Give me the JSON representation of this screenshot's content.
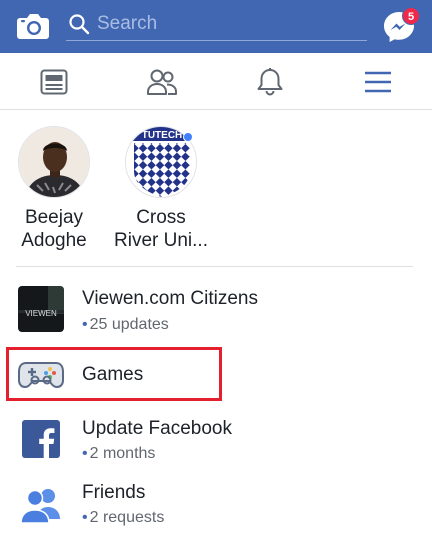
{
  "colors": {
    "brand": "#4267b2",
    "badge": "#f02849",
    "online": "#4080ff",
    "highlight": "#e5202e"
  },
  "topbar": {
    "camera_icon": "camera-icon",
    "search": {
      "placeholder": "Search",
      "value": ""
    },
    "messenger": {
      "icon": "messenger-icon",
      "badge_count": "5"
    }
  },
  "tabs": [
    {
      "name": "news-feed",
      "icon": "news-feed-icon",
      "active": false
    },
    {
      "name": "friends",
      "icon": "friends-icon",
      "active": false
    },
    {
      "name": "notifications",
      "icon": "bell-icon",
      "active": false
    },
    {
      "name": "menu",
      "icon": "menu-icon",
      "active": true
    }
  ],
  "shortcuts": [
    {
      "line1": "Beejay",
      "line2": "Adoghe",
      "online": false
    },
    {
      "line1": "Cross",
      "line2": "River Uni...",
      "online": true,
      "avatar_text": "TUTECH"
    }
  ],
  "menu_items": [
    {
      "title": "Viewen.com Citizens",
      "subtitle": "25 updates",
      "icon": "group-thumbnail",
      "thumb_text": "VIEWEN"
    },
    {
      "title": "Games",
      "subtitle": "",
      "icon": "game-controller-icon",
      "highlighted": true
    },
    {
      "title": "Update Facebook",
      "subtitle": "2 months",
      "icon": "facebook-logo-icon"
    },
    {
      "title": "Friends",
      "subtitle": "2 requests",
      "icon": "friends-icon"
    }
  ]
}
